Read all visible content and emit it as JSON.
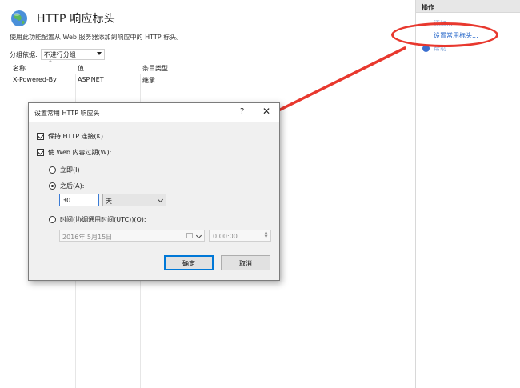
{
  "page": {
    "title": "HTTP 响应标头",
    "description": "使用此功能配置从 Web 服务器添加到响应中的 HTTP 标头。"
  },
  "group": {
    "label": "分组依据:",
    "value": "不进行分组"
  },
  "table": {
    "columns": [
      "名称",
      "值",
      "条目类型"
    ],
    "rows": [
      {
        "name": "X-Powered-By",
        "value": "ASP.NET",
        "type": "继承"
      }
    ]
  },
  "actions": {
    "header": "操作",
    "items": [
      {
        "label": "添加..."
      },
      {
        "label": "设置常用标头..."
      },
      {
        "label": "帮助"
      }
    ]
  },
  "dialog": {
    "title": "设置常用 HTTP 响应头",
    "help": "?",
    "close": "✕",
    "keep_alive": {
      "label": "保持 HTTP 连接(K)",
      "checked": true
    },
    "expire": {
      "label": "使 Web 内容过期(W):",
      "checked": true
    },
    "immediately": {
      "label": "立即(I)",
      "selected": false
    },
    "after": {
      "label": "之后(A):",
      "selected": true
    },
    "after_value": "30",
    "after_unit": "天",
    "utc": {
      "label": "时间(协调通用时间(UTC))(O):",
      "selected": false
    },
    "date_value": "2016年  5月15日",
    "time_value": "0:00:00",
    "ok": "确定",
    "cancel": "取消"
  },
  "colors": {
    "annotation": "#e8382e",
    "link": "#2264c8",
    "focus": "#0078d7"
  }
}
